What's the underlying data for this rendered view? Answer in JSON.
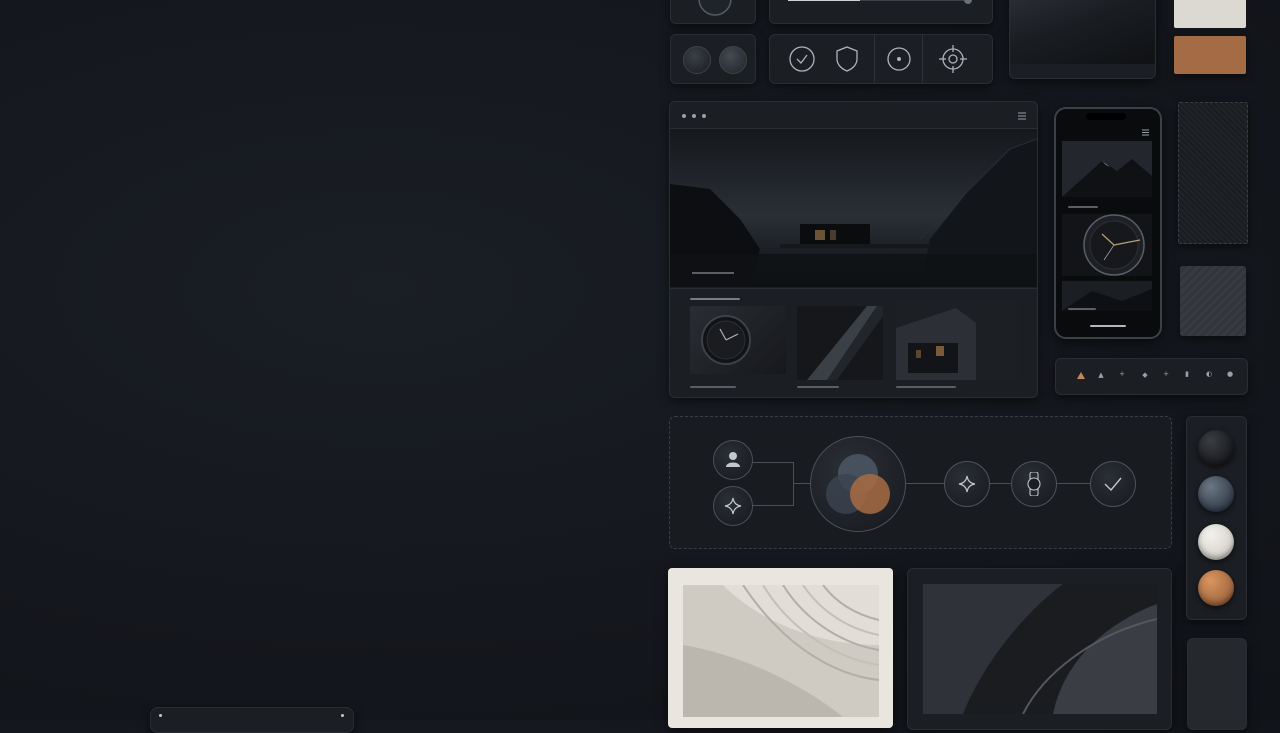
{
  "colors": {
    "background": "#14171d",
    "panel": "#1b1e23",
    "accent_copper": "#b5764c",
    "accent_slate": "#4a5563",
    "accent_ivory": "#ddd9d1"
  },
  "controls_row": {
    "knobs": [
      "toggle-knob-left",
      "toggle-knob-right"
    ],
    "icons": [
      "clock-check-icon",
      "shield-icon",
      "dot-circle-icon",
      "target-icon"
    ]
  },
  "browser_mockup": {
    "dots": [
      "window-dot",
      "window-dot",
      "window-dot"
    ],
    "menu_icon": "hamburger-menu-icon",
    "hero_image": "dark-landscape-architecture-image",
    "thumbnails": [
      "watch-thumbnail",
      "diagonal-stripe-thumbnail",
      "building-night-thumbnail"
    ]
  },
  "phone_mockup": {
    "screens": [
      "mountain-image",
      "watch-image",
      "landscape-image"
    ]
  },
  "icon_strip": {
    "icons": [
      "warning-icon",
      "mountain-icon",
      "plus-icon",
      "diamond-icon",
      "plus-small-icon",
      "bookmark-icon",
      "moon-icon",
      "dot-icon"
    ]
  },
  "workflow": {
    "nodes": [
      "user-icon",
      "sparkle-icon",
      "venn-icon",
      "sparkle-icon",
      "watch-icon",
      "check-icon"
    ]
  },
  "swatches": [
    "#1c1e22",
    "#3b4552",
    "#d9d6cf",
    "#a86c43"
  ]
}
